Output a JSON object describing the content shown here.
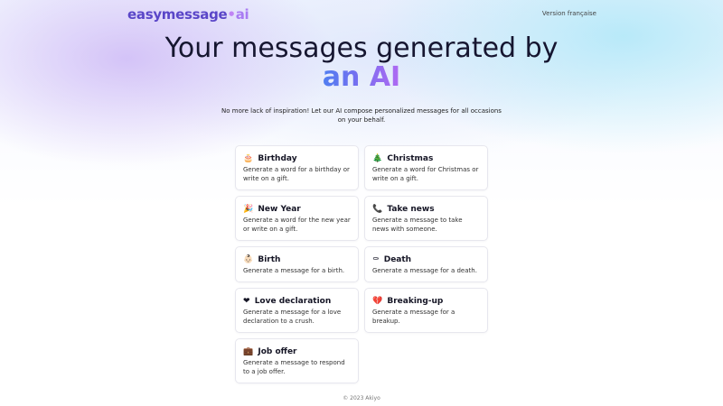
{
  "header": {
    "logo": {
      "brand": "easymessage",
      "dot": "•",
      "ai": "ai"
    },
    "language_link": "Version française"
  },
  "hero": {
    "title_line1": "Your messages generated by",
    "title_line2": "an AI",
    "subtitle": "No more lack of inspiration! Let our AI compose personalized messages for all occasions on your behalf."
  },
  "occasions": [
    {
      "emoji": "🎂",
      "title": "Birthday",
      "description": "Generate a word for a birthday or write on a gift."
    },
    {
      "emoji": "🎄",
      "title": "Christmas",
      "description": "Generate a word for Christmas or write on a gift."
    },
    {
      "emoji": "🎉",
      "title": "New Year",
      "description": "Generate a word for the new year or write on a gift."
    },
    {
      "emoji": "📞",
      "title": "Take news",
      "description": "Generate a message to take news with someone."
    },
    {
      "emoji": "👶🏻",
      "title": "Birth",
      "description": "Generate a message for a birth."
    },
    {
      "emoji": "⚰",
      "title": "Death",
      "description": "Generate a message for a death."
    },
    {
      "emoji": "❤",
      "title": "Love declaration",
      "description": "Generate a message for a love declaration to a crush."
    },
    {
      "emoji": "💔",
      "title": "Breaking-up",
      "description": "Generate a message for a breakup."
    },
    {
      "emoji": "💼",
      "title": "Job offer",
      "description": "Generate a message to respond to a job offer."
    }
  ],
  "footer": {
    "copyright": "© 2023 Akiyo"
  },
  "colors": {
    "brand": "#5a46c8",
    "accent_start": "#4f7df0",
    "accent_end": "#b06af2"
  }
}
